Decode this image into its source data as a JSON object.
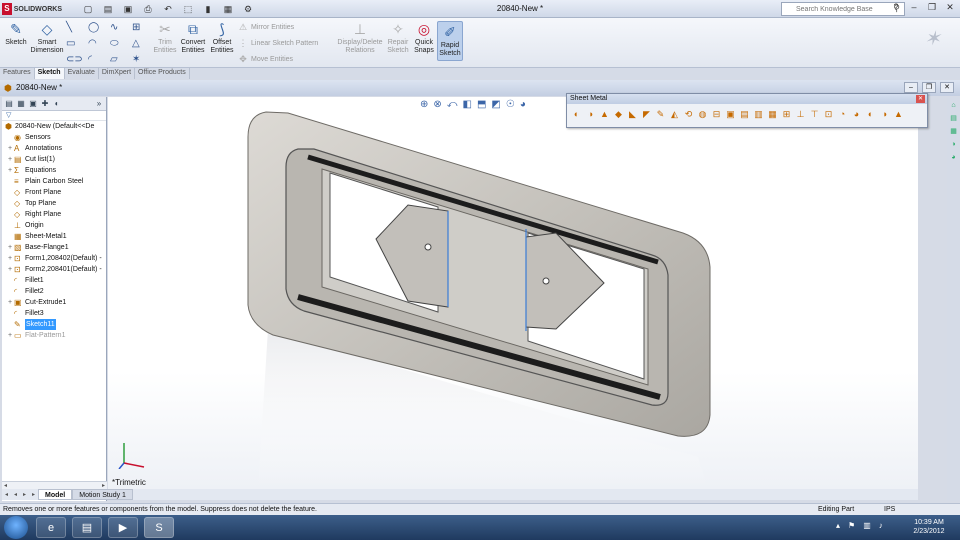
{
  "app": {
    "logo_text": "SOLIDWORKS",
    "window_title": "20840-New *",
    "search_placeholder": "Search Knowledge Base"
  },
  "ribbon": {
    "sketch": "Sketch",
    "smart_dimension": "Smart Dimension",
    "trim_entities": "Trim Entities",
    "convert_entities": "Convert Entities",
    "offset_entities": "Offset Entities",
    "mirror_entities": "Mirror Entities",
    "linear_sketch_pattern": "Linear Sketch Pattern",
    "move_entities": "Move Entities",
    "display_delete_relations": "Display/Delete Relations",
    "repair_sketch": "Repair Sketch",
    "quick_snaps": "Quick Snaps",
    "rapid_sketch": "Rapid Sketch"
  },
  "command_tabs": [
    "Features",
    "Sketch",
    "Evaluate",
    "DimXpert",
    "Office Products"
  ],
  "active_command_tab": "Sketch",
  "document": {
    "title": "20840-New *"
  },
  "feature_tree": [
    {
      "label": "20840-New  (Default<<De",
      "icon": "part-icon",
      "root": true
    },
    {
      "label": "Sensors",
      "icon": "sensor-icon"
    },
    {
      "label": "Annotations",
      "icon": "annotation-icon",
      "expander": "+"
    },
    {
      "label": "Cut list(1)",
      "icon": "cutlist-icon",
      "expander": "+"
    },
    {
      "label": "Equations",
      "icon": "equation-icon",
      "expander": "+"
    },
    {
      "label": "Plain Carbon Steel",
      "icon": "material-icon"
    },
    {
      "label": "Front Plane",
      "icon": "plane-icon"
    },
    {
      "label": "Top Plane",
      "icon": "plane-icon"
    },
    {
      "label": "Right Plane",
      "icon": "plane-icon"
    },
    {
      "label": "Origin",
      "icon": "origin-icon"
    },
    {
      "label": "Sheet-Metal1",
      "icon": "sheet-metal-icon"
    },
    {
      "label": "Base-Flange1",
      "icon": "base-flange-icon",
      "expander": "+"
    },
    {
      "label": "Form1,208402(Default) -",
      "icon": "form-tool-icon",
      "expander": "+"
    },
    {
      "label": "Form2,208401(Default) -",
      "icon": "form-tool-icon",
      "expander": "+"
    },
    {
      "label": "Fillet1",
      "icon": "fillet-icon"
    },
    {
      "label": "Fillet2",
      "icon": "fillet-icon"
    },
    {
      "label": "Cut-Extrude1",
      "icon": "cut-extrude-icon",
      "expander": "+"
    },
    {
      "label": "Fillet3",
      "icon": "fillet-icon"
    },
    {
      "label": "Sketch11",
      "icon": "sketch-icon",
      "selected": true
    },
    {
      "label": "Flat-Pattern1",
      "icon": "flat-pattern-icon",
      "expander": "+",
      "suppressed": true
    }
  ],
  "viewport": {
    "view_name": "*Trimetric"
  },
  "sheet_metal_toolbar": {
    "title": "Sheet Metal",
    "button_count": 28
  },
  "bottom_tabs": [
    "Model",
    "Motion Study 1"
  ],
  "active_bottom_tab": "Model",
  "status": {
    "message": "Removes one or more features or components from the model. Suppress does not delete the feature.",
    "mode": "Editing Part",
    "units": "IPS"
  },
  "taskbar": {
    "time": "10:39 AM",
    "date": "2/23/2012"
  },
  "colors": {
    "accent": "#3399ff",
    "part_face": "#c9c6c0",
    "part_edge": "#4a4a4a"
  }
}
